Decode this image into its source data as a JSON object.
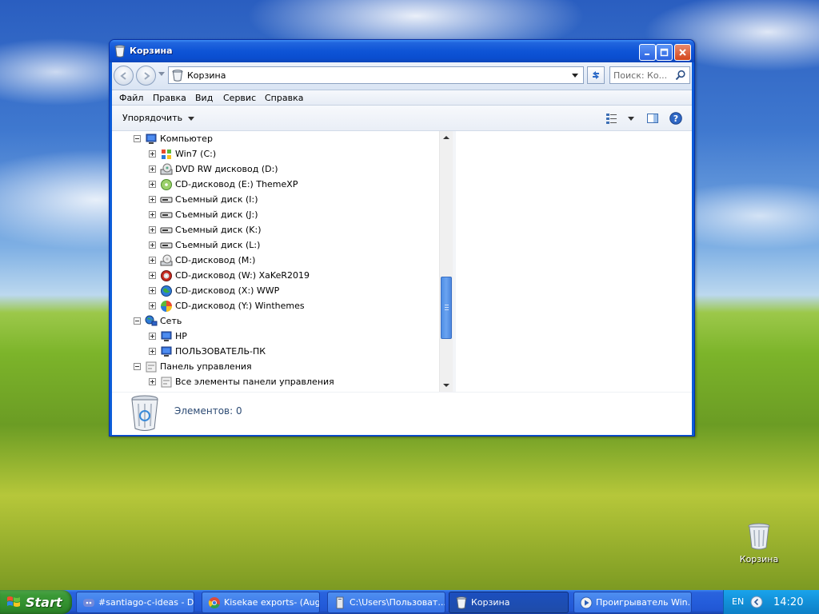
{
  "window": {
    "title": "Корзина",
    "controls": {
      "minimize": "minimize-icon",
      "maximize": "maximize-icon",
      "close": "close-icon"
    }
  },
  "address_bar": {
    "path": "Корзина",
    "search_placeholder": "Поиск: Ко..."
  },
  "menu": [
    "Файл",
    "Правка",
    "Вид",
    "Сервис",
    "Справка"
  ],
  "command_bar": {
    "organize": "Упорядочить"
  },
  "tree": [
    {
      "label": "Компьютер",
      "level": 0,
      "expanded": true,
      "icon": "computer-icon"
    },
    {
      "label": "Win7 (C:)",
      "level": 1,
      "expanded": false,
      "icon": "windows-drive-icon"
    },
    {
      "label": "DVD RW дисковод (D:)",
      "level": 1,
      "expanded": false,
      "icon": "dvd-drive-icon"
    },
    {
      "label": "CD-дисковод (E:) ThemeXP",
      "level": 1,
      "expanded": false,
      "icon": "cd-drive-icon"
    },
    {
      "label": "Съемный диск (I:)",
      "level": 1,
      "expanded": false,
      "icon": "removable-drive-icon"
    },
    {
      "label": "Съемный диск (J:)",
      "level": 1,
      "expanded": false,
      "icon": "removable-drive-icon"
    },
    {
      "label": "Съемный диск (K:)",
      "level": 1,
      "expanded": false,
      "icon": "removable-drive-icon"
    },
    {
      "label": "Съемный диск (L:)",
      "level": 1,
      "expanded": false,
      "icon": "removable-drive-icon"
    },
    {
      "label": "CD-дисковод (M:)",
      "level": 1,
      "expanded": false,
      "icon": "cd-drive-icon"
    },
    {
      "label": "CD-дисковод (W:) XaKeR2019",
      "level": 1,
      "expanded": false,
      "icon": "disc-red-icon"
    },
    {
      "label": "CD-дисковод (X:) WWP",
      "level": 1,
      "expanded": false,
      "icon": "globe-disc-icon"
    },
    {
      "label": "CD-дисковод (Y:) Winthemes",
      "level": 1,
      "expanded": false,
      "icon": "colorful-disc-icon"
    },
    {
      "label": "Сеть",
      "level": 0,
      "expanded": true,
      "icon": "network-icon"
    },
    {
      "label": "HP",
      "level": 1,
      "expanded": false,
      "icon": "computer-icon"
    },
    {
      "label": "ПОЛЬЗОВАТЕЛЬ-ПК",
      "level": 1,
      "expanded": false,
      "icon": "computer-icon"
    },
    {
      "label": "Панель управления",
      "level": 0,
      "expanded": true,
      "icon": "control-panel-icon"
    },
    {
      "label": "Все элементы панели управления",
      "level": 1,
      "expanded": false,
      "icon": "control-panel-icon"
    }
  ],
  "details": {
    "items_count": "Элементов: 0"
  },
  "desktop": {
    "icons": [
      {
        "label": "Корзина",
        "icon": "recycle-bin-icon"
      }
    ]
  },
  "taskbar": {
    "start": "Start",
    "tasks": [
      {
        "label": "#santiago-c-ideas - Di...",
        "icon": "discord-icon",
        "active": false
      },
      {
        "label": "Kisekae exports- (Aug...",
        "icon": "chrome-icon",
        "active": false
      },
      {
        "label": "C:\\Users\\Пользоват...",
        "icon": "folder-icon",
        "active": false
      },
      {
        "label": "Корзина",
        "icon": "recycle-bin-icon",
        "active": true
      },
      {
        "label": "Проигрыватель Win...",
        "icon": "media-player-icon",
        "active": false
      }
    ],
    "tray": {
      "language": "EN",
      "clock": "14:20"
    }
  },
  "colors": {
    "window_frame": "#0b5bd8",
    "taskbar": "#245ddb",
    "start_button": "#3c9a37",
    "tray": "#1290d8",
    "details_text": "#2c4a73"
  }
}
